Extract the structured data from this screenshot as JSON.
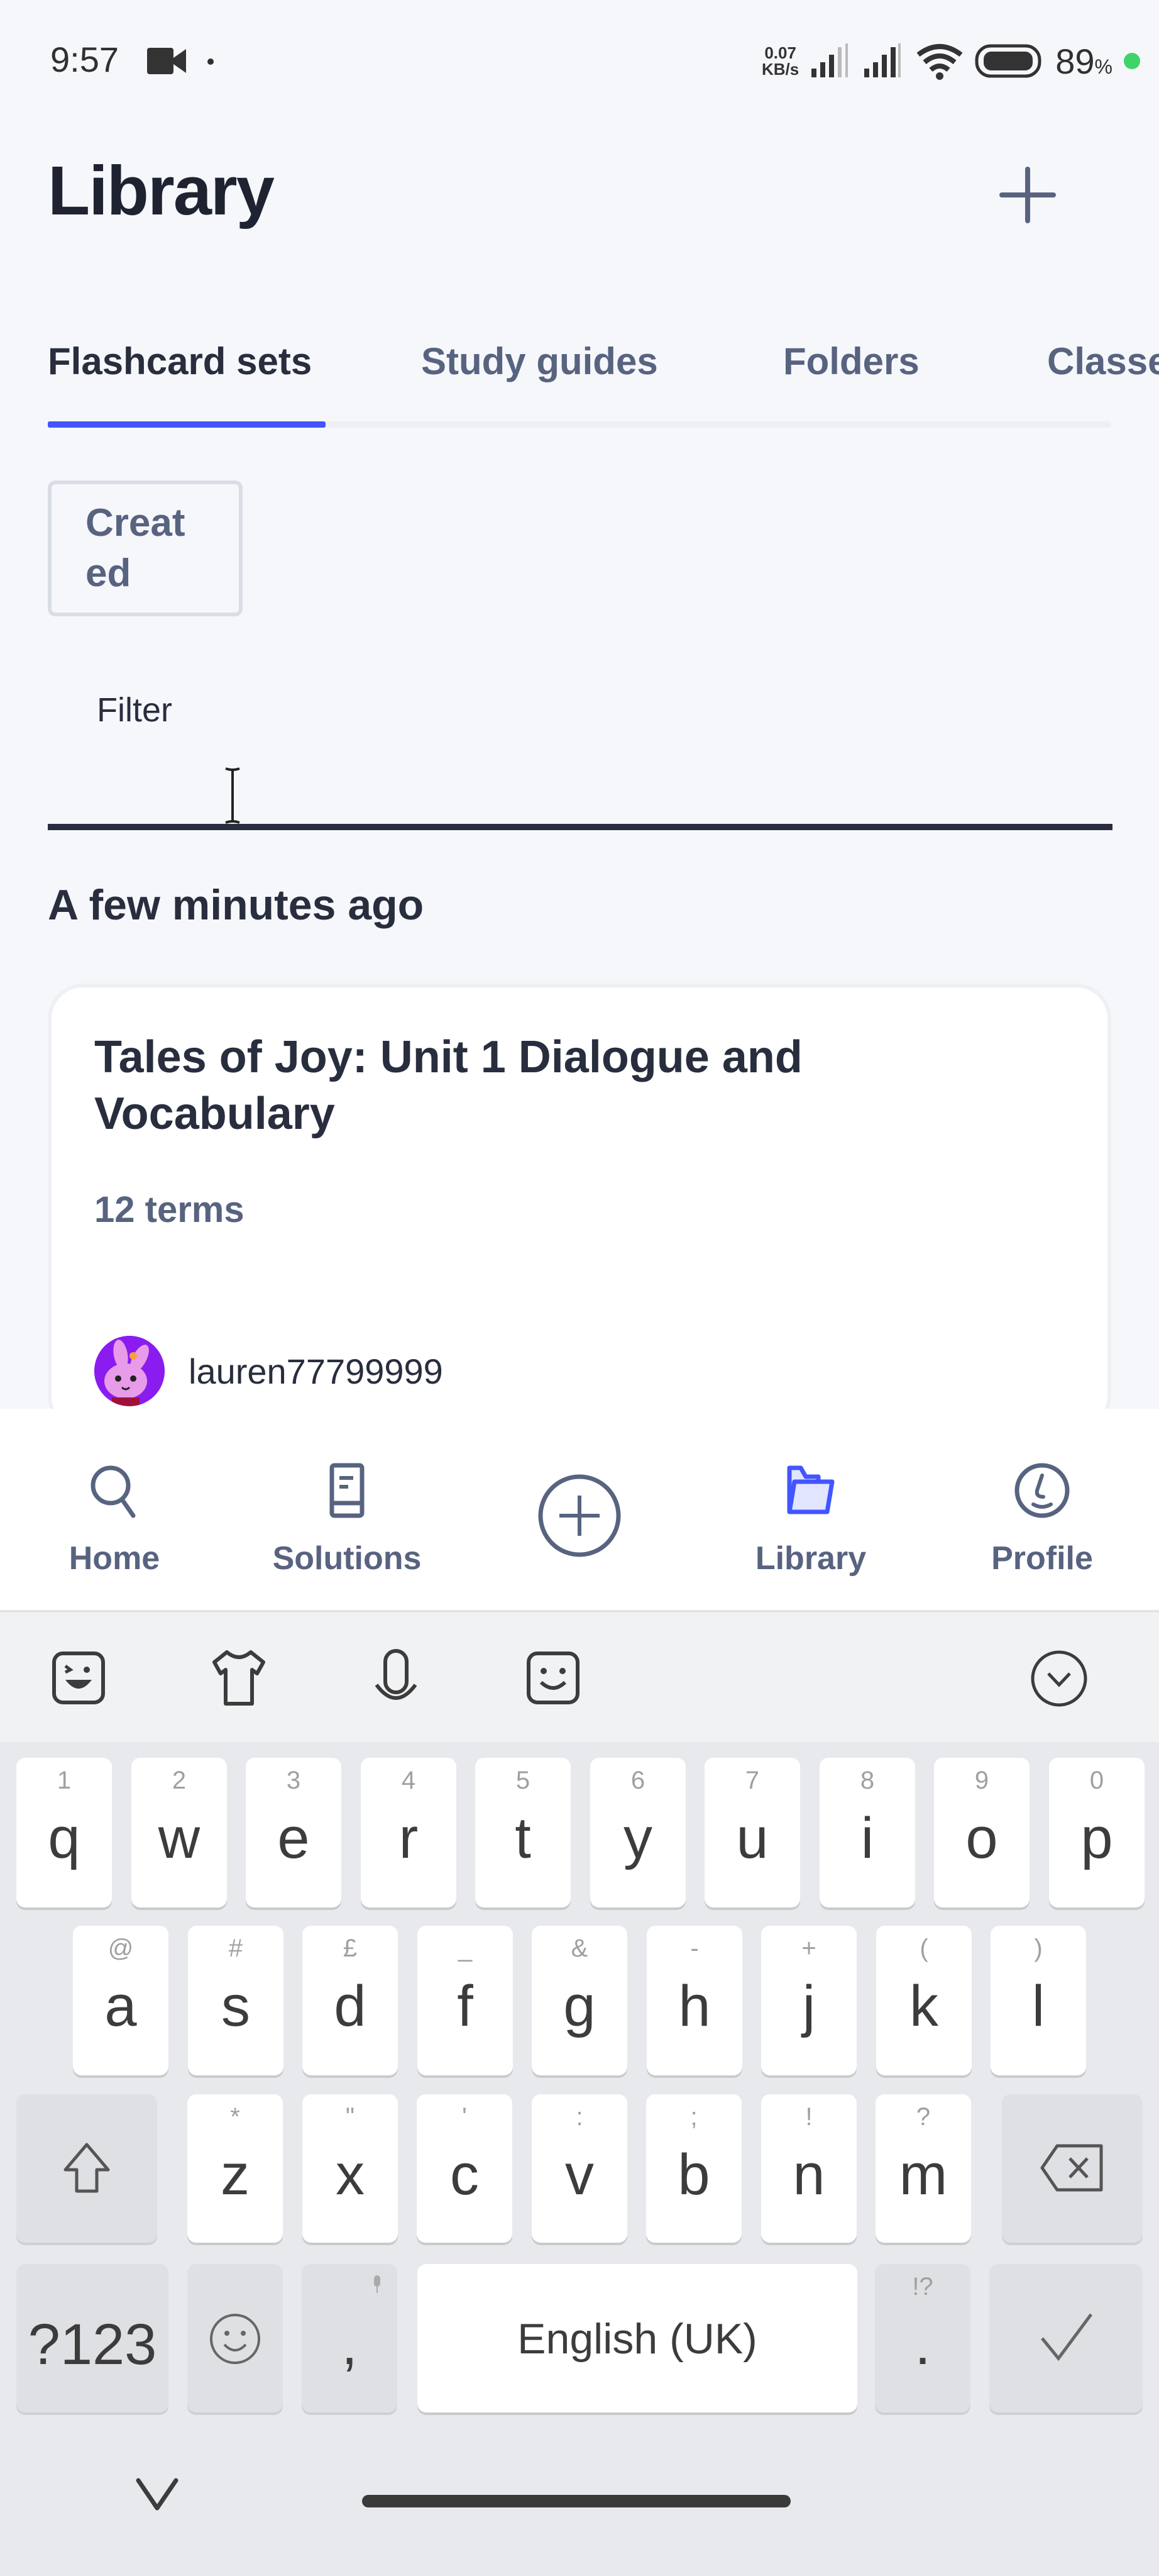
{
  "status_bar": {
    "time": "9:57",
    "net_speed_value": "0.07",
    "net_speed_unit": "KB/s",
    "battery_percent": "89",
    "battery_unit": "%",
    "colors": {
      "charging_dot": "#3fd46a"
    }
  },
  "header": {
    "title": "Library",
    "add_icon": "plus-icon"
  },
  "tabs": [
    {
      "label": "Flashcard sets",
      "active": true
    },
    {
      "label": "Study guides",
      "active": false
    },
    {
      "label": "Folders",
      "active": false
    },
    {
      "label": "Classes",
      "active": false
    }
  ],
  "filters": {
    "sort_chip_line1": "Creat",
    "sort_chip_line2": "ed",
    "filter_label": "Filter",
    "filter_value": ""
  },
  "sections": [
    {
      "heading": "A few minutes ago",
      "items": [
        {
          "title": "Tales of Joy: Unit 1 Dialogue and Vocabulary",
          "terms": "12 terms",
          "author": "lauren77799999"
        }
      ]
    }
  ],
  "bottom_nav": [
    {
      "label": "Home",
      "icon": "search-icon",
      "active": false
    },
    {
      "label": "Solutions",
      "icon": "book-icon",
      "active": false
    },
    {
      "label": "",
      "icon": "plus-circle-icon",
      "active": false
    },
    {
      "label": "Library",
      "icon": "folder-icon",
      "active": true
    },
    {
      "label": "Profile",
      "icon": "profile-icon",
      "active": false
    }
  ],
  "keyboard": {
    "toolbar": [
      "sticker-icon",
      "theme-shirt-icon",
      "microphone-icon",
      "emoji-board-icon",
      "collapse-icon"
    ],
    "row1": [
      {
        "k": "q",
        "h": "1"
      },
      {
        "k": "w",
        "h": "2"
      },
      {
        "k": "e",
        "h": "3"
      },
      {
        "k": "r",
        "h": "4"
      },
      {
        "k": "t",
        "h": "5"
      },
      {
        "k": "y",
        "h": "6"
      },
      {
        "k": "u",
        "h": "7"
      },
      {
        "k": "i",
        "h": "8"
      },
      {
        "k": "o",
        "h": "9"
      },
      {
        "k": "p",
        "h": "0"
      }
    ],
    "row2": [
      {
        "k": "a",
        "h": "@"
      },
      {
        "k": "s",
        "h": "#"
      },
      {
        "k": "d",
        "h": "£"
      },
      {
        "k": "f",
        "h": "_"
      },
      {
        "k": "g",
        "h": "&"
      },
      {
        "k": "h",
        "h": "-"
      },
      {
        "k": "j",
        "h": "+"
      },
      {
        "k": "k",
        "h": "("
      },
      {
        "k": "l",
        "h": ")"
      }
    ],
    "row3": [
      {
        "k": "z",
        "h": "*"
      },
      {
        "k": "x",
        "h": "\""
      },
      {
        "k": "c",
        "h": "'"
      },
      {
        "k": "v",
        "h": ":"
      },
      {
        "k": "b",
        "h": ";"
      },
      {
        "k": "n",
        "h": "!"
      },
      {
        "k": "m",
        "h": "?"
      }
    ],
    "symbols_label": "?123",
    "comma_label": ",",
    "space_label": "English (UK)",
    "period_label": ".",
    "period_hint": "!?"
  },
  "colors": {
    "accent": "#4255ff",
    "text_primary": "#282e3e",
    "text_secondary": "#586380",
    "background": "#f6f7fb"
  }
}
